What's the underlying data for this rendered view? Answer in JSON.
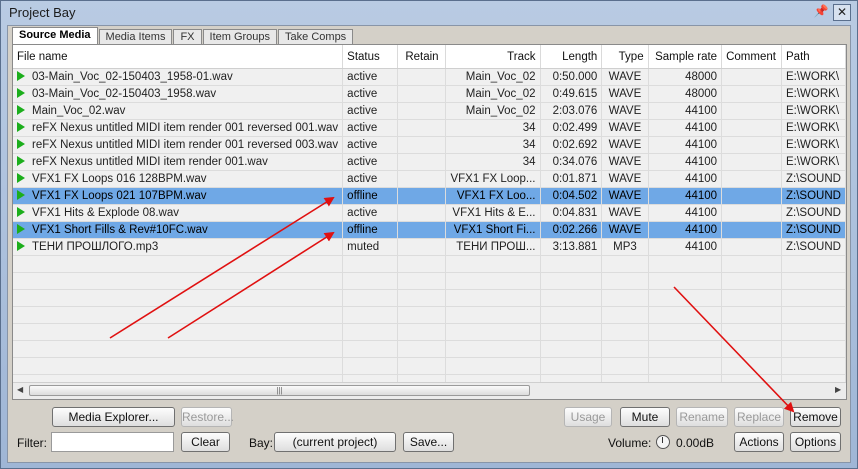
{
  "window": {
    "title": "Project Bay",
    "pin_icon": "pin-icon",
    "close_icon": "close-icon"
  },
  "tabs": [
    "Source Media",
    "Media Items",
    "FX",
    "Item Groups",
    "Take Comps"
  ],
  "columns": [
    "File name",
    "Status",
    "Retain",
    "Track",
    "Length",
    "Type",
    "Sample rate",
    "Comment",
    "Path"
  ],
  "rows": [
    {
      "name": "03-Main_Voc_02-150403_1958-01.wav",
      "status": "active",
      "retain": "",
      "track": "Main_Voc_02",
      "length": "0:50.000",
      "type": "WAVE",
      "rate": "48000",
      "comment": "",
      "path": "E:\\WORK\\",
      "selected": false
    },
    {
      "name": "03-Main_Voc_02-150403_1958.wav",
      "status": "active",
      "retain": "",
      "track": "Main_Voc_02",
      "length": "0:49.615",
      "type": "WAVE",
      "rate": "48000",
      "comment": "",
      "path": "E:\\WORK\\",
      "selected": false
    },
    {
      "name": "Main_Voc_02.wav",
      "status": "active",
      "retain": "",
      "track": "Main_Voc_02",
      "length": "2:03.076",
      "type": "WAVE",
      "rate": "44100",
      "comment": "",
      "path": "E:\\WORK\\",
      "selected": false
    },
    {
      "name": "reFX Nexus untitled MIDI item render 001 reversed 001.wav",
      "status": "active",
      "retain": "",
      "track": "34",
      "length": "0:02.499",
      "type": "WAVE",
      "rate": "44100",
      "comment": "",
      "path": "E:\\WORK\\",
      "selected": false
    },
    {
      "name": "reFX Nexus untitled MIDI item render 001 reversed 003.wav",
      "status": "active",
      "retain": "",
      "track": "34",
      "length": "0:02.692",
      "type": "WAVE",
      "rate": "44100",
      "comment": "",
      "path": "E:\\WORK\\",
      "selected": false
    },
    {
      "name": "reFX Nexus untitled MIDI item render 001.wav",
      "status": "active",
      "retain": "",
      "track": "34",
      "length": "0:34.076",
      "type": "WAVE",
      "rate": "44100",
      "comment": "",
      "path": "E:\\WORK\\",
      "selected": false
    },
    {
      "name": "VFX1 FX Loops 016 128BPM.wav",
      "status": "active",
      "retain": "",
      "track": "VFX1 FX Loop...",
      "length": "0:01.871",
      "type": "WAVE",
      "rate": "44100",
      "comment": "",
      "path": "Z:\\SOUND",
      "selected": false
    },
    {
      "name": "VFX1 FX Loops 021 107BPM.wav",
      "status": "offline",
      "retain": "",
      "track": "VFX1 FX Loo...",
      "length": "0:04.502",
      "type": "WAVE",
      "rate": "44100",
      "comment": "",
      "path": "Z:\\SOUND",
      "selected": true
    },
    {
      "name": "VFX1 Hits & Explode 08.wav",
      "status": "active",
      "retain": "",
      "track": "VFX1 Hits & E...",
      "length": "0:04.831",
      "type": "WAVE",
      "rate": "44100",
      "comment": "",
      "path": "Z:\\SOUND",
      "selected": false
    },
    {
      "name": "VFX1 Short Fills & Rev#10FC.wav",
      "status": "offline",
      "retain": "",
      "track": "VFX1 Short Fi...",
      "length": "0:02.266",
      "type": "WAVE",
      "rate": "44100",
      "comment": "",
      "path": "Z:\\SOUND",
      "selected": true
    },
    {
      "name": "ТЕНИ ПРОШЛОГО.mp3",
      "status": "muted",
      "retain": "",
      "track": "ТЕНИ ПРОШ...",
      "length": "3:13.881",
      "type": "MP3",
      "rate": "44100",
      "comment": "",
      "path": "Z:\\SOUND",
      "selected": false
    }
  ],
  "buttons": {
    "media_explorer": "Media Explorer...",
    "restore": "Restore...",
    "usage": "Usage",
    "mute": "Mute",
    "rename": "Rename",
    "replace": "Replace",
    "remove": "Remove",
    "clear": "Clear",
    "bay_select": "(current project)",
    "save": "Save...",
    "actions": "Actions",
    "options": "Options"
  },
  "labels": {
    "filter": "Filter:",
    "bay": "Bay:",
    "volume": "Volume:",
    "volume_value": "0.00dB"
  },
  "filter_value": "",
  "colors": {
    "selected_row": "#6fa8e6",
    "annotation_arrow": "#e01010",
    "play_icon": "#1cae1c"
  }
}
